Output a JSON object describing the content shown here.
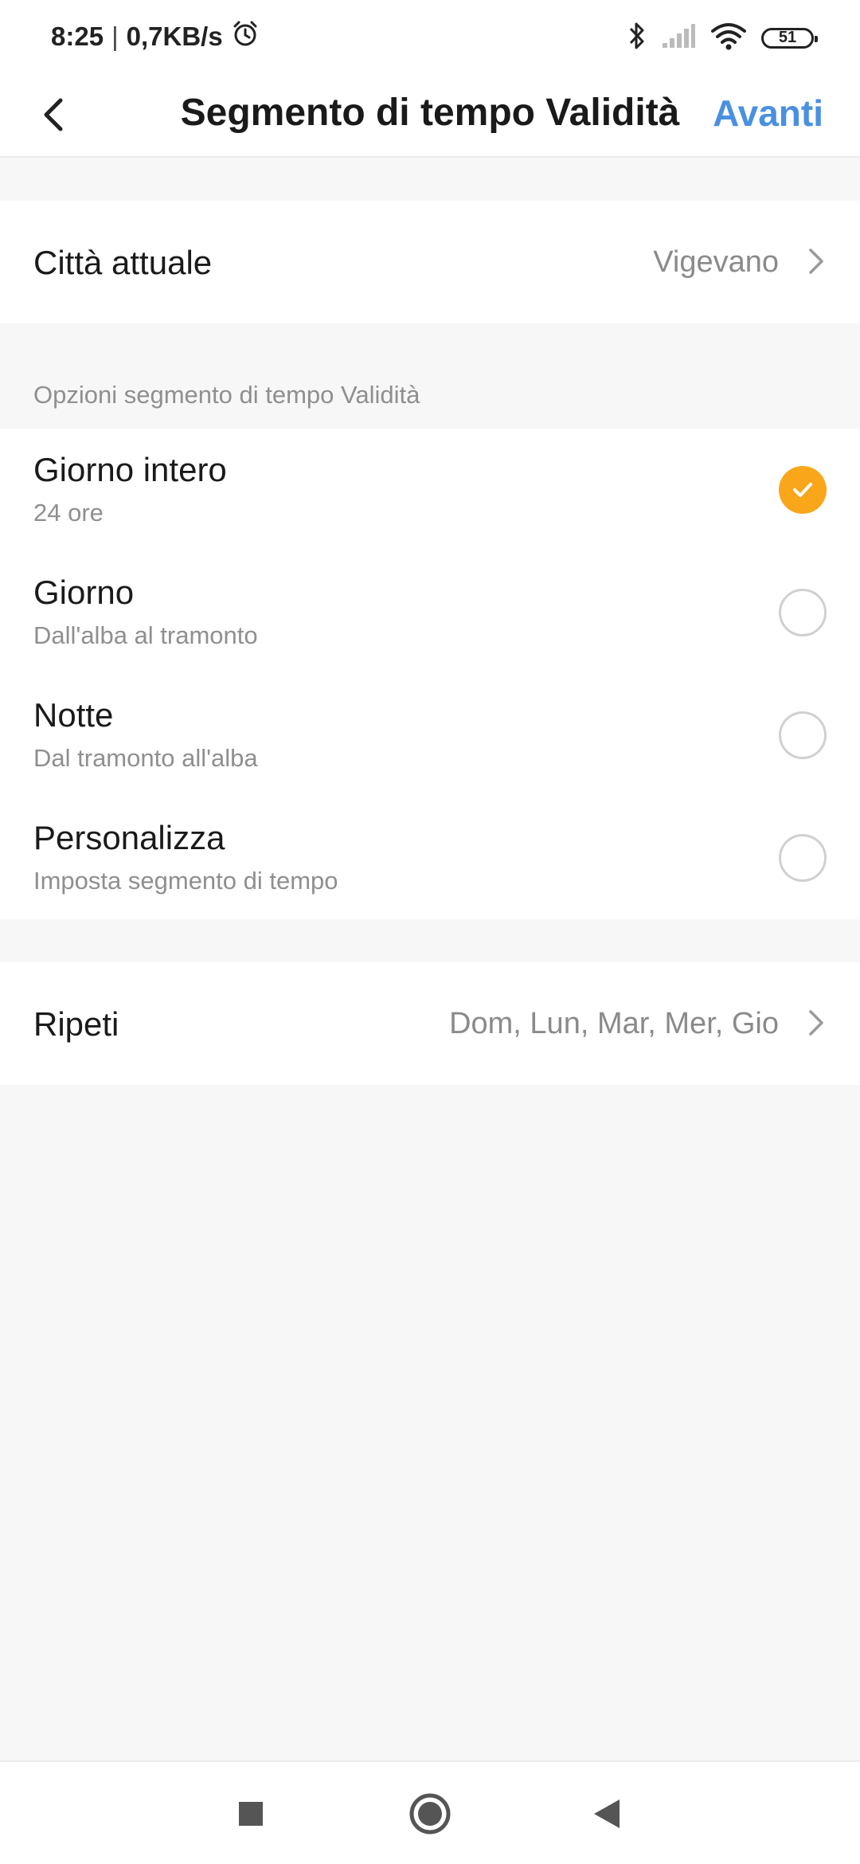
{
  "status_bar": {
    "time": "8:25",
    "separator": "|",
    "network_speed": "0,7KB/s",
    "battery_level": "51",
    "icons": [
      "alarm-icon",
      "bluetooth-icon",
      "signal-icon",
      "wifi-icon",
      "battery-icon"
    ]
  },
  "header": {
    "title": "Segmento di tempo Validità",
    "next_label": "Avanti",
    "back_icon": "chevron-left-icon",
    "accent_color": "#4a90e2"
  },
  "city": {
    "label": "Città attuale",
    "value": "Vigevano"
  },
  "options_section": {
    "caption": "Opzioni segmento di tempo Validità",
    "selected_color": "#f9a61a",
    "options": [
      {
        "title": "Giorno intero",
        "subtitle": "24 ore",
        "selected": true
      },
      {
        "title": "Giorno",
        "subtitle": "Dall'alba al tramonto",
        "selected": false
      },
      {
        "title": "Notte",
        "subtitle": "Dal tramonto all'alba",
        "selected": false
      },
      {
        "title": "Personalizza",
        "subtitle": "Imposta segmento di tempo",
        "selected": false
      }
    ]
  },
  "repeat": {
    "label": "Ripeti",
    "value": "Dom, Lun, Mar, Mer, Gio"
  },
  "nav_bar": {
    "icons": [
      "recent-apps-icon",
      "home-icon",
      "back-icon"
    ]
  }
}
